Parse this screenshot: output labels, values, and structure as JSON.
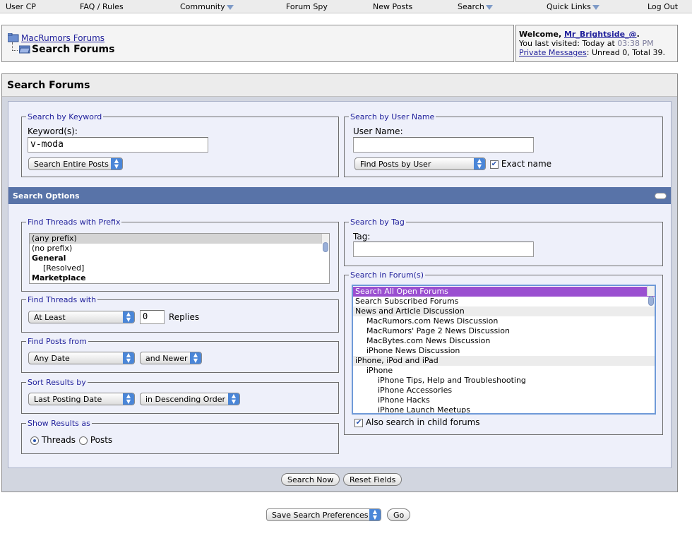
{
  "nav": {
    "items": [
      {
        "label": "User CP"
      },
      {
        "label": "FAQ / Rules"
      },
      {
        "label": "Community"
      },
      {
        "label": "Forum Spy"
      },
      {
        "label": "New Posts"
      },
      {
        "label": "Search"
      },
      {
        "label": "Quick Links"
      },
      {
        "label": "Log Out"
      }
    ]
  },
  "breadcrumb": {
    "forum_link": "MacRumors Forums",
    "current": "Search Forums"
  },
  "welcome": {
    "prefix": "Welcome, ",
    "username": "Mr_Brightside_@",
    "suffix": ".",
    "last_visited_label": "You last visited: Today at ",
    "last_visited_time": "03:38 PM",
    "pm_link": "Private Messages",
    "pm_status": ": Unread 0, Total 39."
  },
  "page_title": "Search Forums",
  "keyword_search": {
    "legend": "Search by Keyword",
    "label": "Keyword(s):",
    "value": "v-moda",
    "mode": "Search Entire Posts"
  },
  "user_search": {
    "legend": "Search by User Name",
    "label": "User Name:",
    "value": "",
    "mode": "Find Posts by User",
    "exact_label": "Exact name",
    "exact_checked": true
  },
  "options_title": "Search Options",
  "prefix": {
    "legend": "Find Threads with Prefix",
    "items": [
      "(any prefix)",
      "(no prefix)",
      "General",
      "[Resolved]",
      "Marketplace"
    ]
  },
  "replies": {
    "legend": "Find Threads with",
    "mode": "At Least",
    "value": "0",
    "suffix": "Replies"
  },
  "posts_from": {
    "legend": "Find Posts from",
    "date": "Any Date",
    "direction": "and Newer"
  },
  "sort": {
    "legend": "Sort Results by",
    "field": "Last Posting Date",
    "order": "in Descending Order"
  },
  "show_as": {
    "legend": "Show Results as",
    "threads": "Threads",
    "posts": "Posts",
    "selected": "Threads"
  },
  "tag": {
    "legend": "Search by Tag",
    "label": "Tag:",
    "value": ""
  },
  "forums": {
    "legend": "Search in Forum(s)",
    "items": [
      {
        "label": "Search All Open Forums",
        "level": 0,
        "selected": true
      },
      {
        "label": "Search Subscribed Forums",
        "level": 0
      },
      {
        "label": "News and Article Discussion",
        "level": 0,
        "category": true
      },
      {
        "label": "MacRumors.com News Discussion",
        "level": 1
      },
      {
        "label": "MacRumors' Page 2 News Discussion",
        "level": 1
      },
      {
        "label": "MacBytes.com News Discussion",
        "level": 1
      },
      {
        "label": "iPhone News Discussion",
        "level": 1
      },
      {
        "label": "iPhone, iPod and iPad",
        "level": 0,
        "category": true
      },
      {
        "label": "iPhone",
        "level": 1
      },
      {
        "label": "iPhone Tips, Help and Troubleshooting",
        "level": 2
      },
      {
        "label": "iPhone Accessories",
        "level": 2
      },
      {
        "label": "iPhone Hacks",
        "level": 2
      },
      {
        "label": "iPhone Launch Meetups",
        "level": 2
      }
    ],
    "child_label": "Also search in child forums",
    "child_checked": true
  },
  "buttons": {
    "search": "Search Now",
    "reset": "Reset Fields"
  },
  "prefs": {
    "select": "Save Search Preferences",
    "go": "Go"
  },
  "colors": {
    "accent": "#5873a8",
    "link": "#22229c",
    "selection": "#9a4fd0"
  }
}
